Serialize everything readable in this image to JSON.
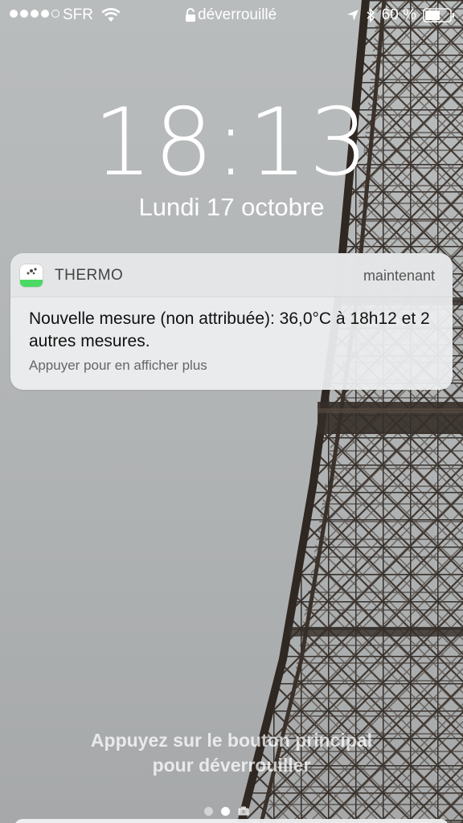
{
  "status_bar": {
    "carrier": "SFR",
    "lock_text": "déverrouillé",
    "battery_percent": "60 %",
    "battery_level": 0.6,
    "signal_bars_filled": 4,
    "signal_bars_total": 5
  },
  "lock_screen": {
    "time": "18:13",
    "date": "Lundi 17 octobre"
  },
  "notification": {
    "app_name": "THERMO",
    "time": "maintenant",
    "message": "Nouvelle mesure (non attribuée): 36,0°C à 18h12 et 2 autres mesures.",
    "hint": "Appuyer pour en afficher plus",
    "accent_color": "#4cd964"
  },
  "bottom": {
    "unlock_line1": "Appuyez sur le bouton principal",
    "unlock_line2": "pour déverrouiller",
    "page_count": 3,
    "active_page": 1
  },
  "icons": [
    "wifi-icon",
    "padlock-icon",
    "location-arrow-icon",
    "bluetooth-icon",
    "battery-icon",
    "thermo-app-icon",
    "camera-icon"
  ]
}
